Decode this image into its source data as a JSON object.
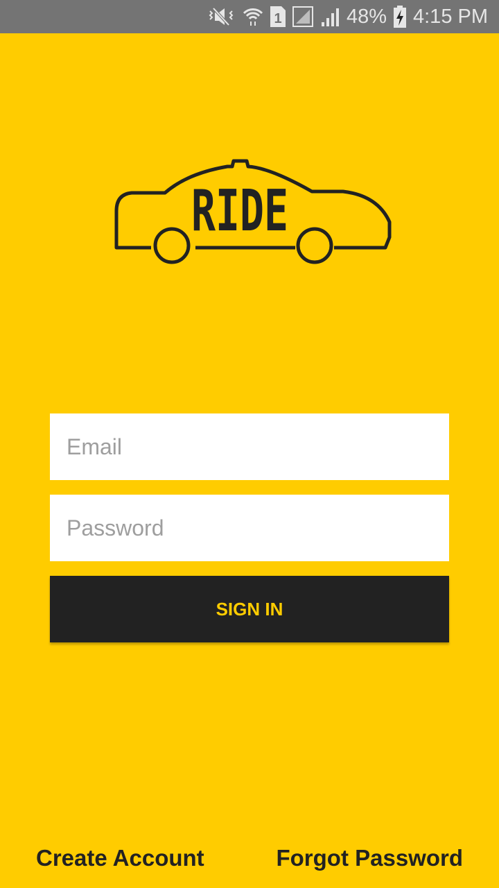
{
  "status_bar": {
    "battery": "48%",
    "time": "4:15 PM",
    "sim_slot": "1",
    "icons": [
      "mute-vibrate-icon",
      "wifi-icon",
      "sim-icon",
      "signal-icon",
      "signal-icon",
      "battery-charging-icon"
    ]
  },
  "logo": {
    "text": "RIDE"
  },
  "form": {
    "email_placeholder": "Email",
    "password_placeholder": "Password",
    "sign_in_label": "SIGN IN"
  },
  "footer": {
    "create_account": "Create Account",
    "forgot_password": "Forgot Password"
  },
  "colors": {
    "background": "#FFCC00",
    "button": "#222222",
    "button_text": "#FFCC00"
  }
}
